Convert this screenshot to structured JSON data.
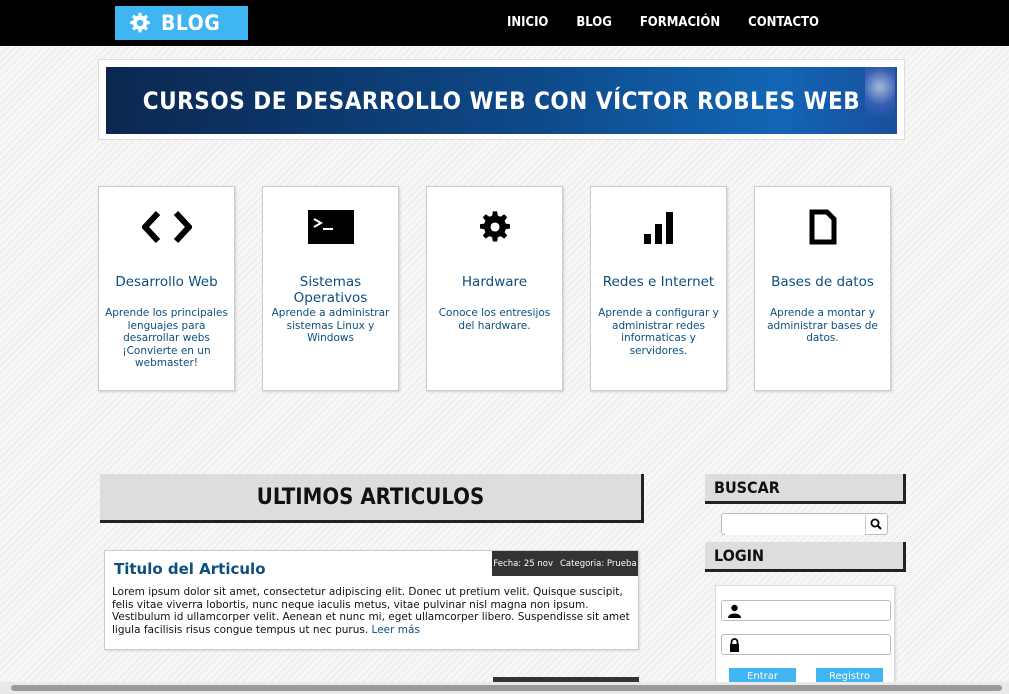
{
  "header": {
    "logo_text": "BLOG",
    "nav": [
      "INICIO",
      "BLOG",
      "FORMACIÓN",
      "CONTACTO"
    ]
  },
  "banner": {
    "text": "CURSOS DE DESARROLLO WEB CON VÍCTOR ROBLES WEB"
  },
  "cards": [
    {
      "icon": "code-icon",
      "title": "Desarrollo Web",
      "desc": "Aprende los principales lenguajes para desarrollar webs ¡Convierte en un webmaster!"
    },
    {
      "icon": "terminal-icon",
      "title": "Sistemas Operativos",
      "desc": "Aprende a administrar sistemas Linux y Windows"
    },
    {
      "icon": "gear-icon",
      "title": "Hardware",
      "desc": "Conoce los entresijos del hardware."
    },
    {
      "icon": "signal-bars-icon",
      "title": "Redes e Internet",
      "desc": "Aprende a configurar y administrar redes informaticas y servidores."
    },
    {
      "icon": "document-icon",
      "title": "Bases de datos",
      "desc": "Aprende a montar y administrar bases de datos."
    }
  ],
  "main": {
    "section_title": "ULTIMOS ARTICULOS"
  },
  "article": {
    "title": "Titulo del Articulo",
    "date": "Fecha: 25 nov",
    "category": "Categoria: Prueba",
    "body": "Lorem ipsum dolor sit amet, consectetur adipiscing elit. Donec ut pretium velit. Quisque suscipit, felis vitae viverra lobortis, nunc neque iaculis metus, vitae pulvinar nisl magna non ipsum. Vestibulum id ullamcorper velit. Aenean et nunc mi, eget ullamcorper libero. Suspendisse sit amet ligula facilisis risus congue tempus ut nec purus.",
    "read_more": "Leer más"
  },
  "sidebar": {
    "search_title": "BUSCAR",
    "search_placeholder": "",
    "login_title": "LOGIN",
    "user_placeholder": "",
    "pass_placeholder": "",
    "btn_enter": "Entrar",
    "btn_register": "Registro"
  },
  "colors": {
    "accent": "#3fb5f2",
    "topbar": "#000000",
    "link": "#0c4f7f"
  }
}
